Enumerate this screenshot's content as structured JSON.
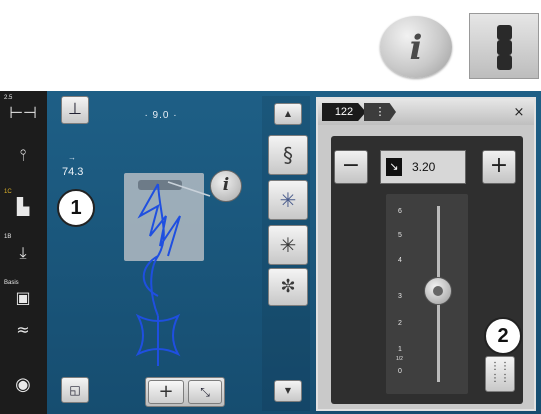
{
  "header": {
    "info_glyph": "i",
    "menu_icon": "vertical-menu-icon"
  },
  "left_bar": {
    "items": [
      {
        "label": "2.5",
        "color": "#e8e8e8"
      },
      {
        "label": "1C",
        "color": "#e0b52a"
      },
      {
        "label": "1B",
        "color": "#e8e8e8"
      },
      {
        "label": "Basis",
        "color": "#e8e8e8"
      }
    ]
  },
  "stitch_area": {
    "width_value": "9.0",
    "length_label": "→",
    "length_value": "74.3",
    "info_glyph": "i"
  },
  "callouts": {
    "one": "1",
    "two": "2"
  },
  "panel": {
    "stitch_number": "122",
    "close_glyph": "×",
    "minus": "−",
    "plus": "+",
    "value": "3.20",
    "scale": [
      "6",
      "5",
      "4",
      "3",
      "2",
      "1",
      "1/2",
      "0"
    ]
  },
  "bottom": {
    "plus": "+"
  },
  "colors": {
    "screen": "#1e5f86",
    "stitch_pattern": "#1f4fe0"
  }
}
